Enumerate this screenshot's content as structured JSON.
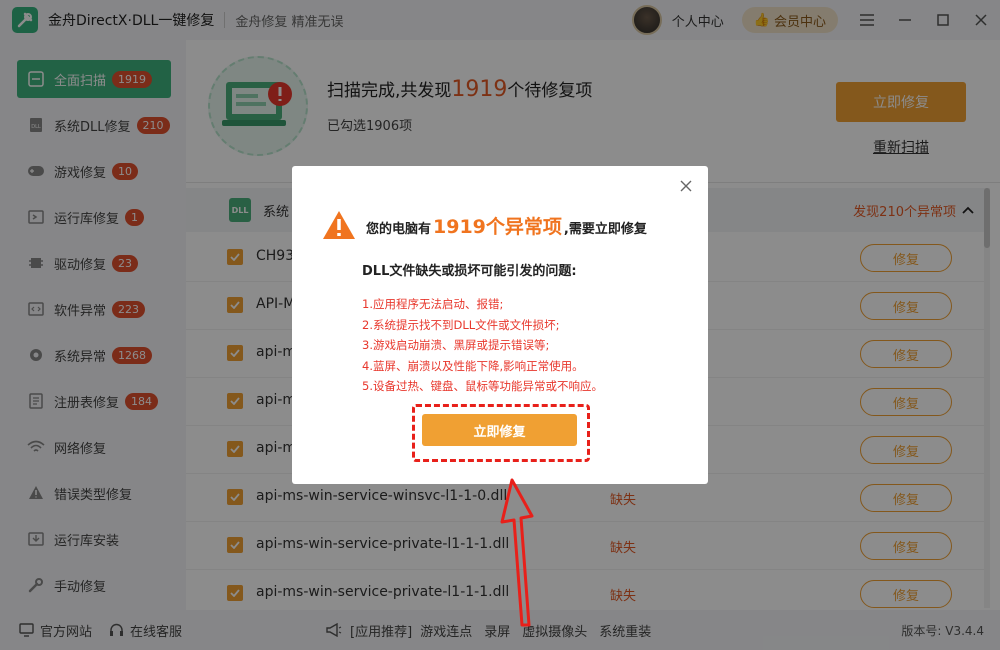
{
  "app": {
    "title": "金舟DirectX·DLL一键修复",
    "slogan": "金舟修复 精准无误",
    "personal_center": "个人中心",
    "vip_center": "会员中心"
  },
  "sidebar": {
    "items": [
      {
        "label": "全面扫描",
        "badge": "1919"
      },
      {
        "label": "系统DLL修复",
        "badge": "210"
      },
      {
        "label": "游戏修复",
        "badge": "10"
      },
      {
        "label": "运行库修复",
        "badge": "1"
      },
      {
        "label": "驱动修复",
        "badge": "23"
      },
      {
        "label": "软件异常",
        "badge": "223"
      },
      {
        "label": "系统异常",
        "badge": "1268"
      },
      {
        "label": "注册表修复",
        "badge": "184"
      },
      {
        "label": "网络修复",
        "badge": ""
      },
      {
        "label": "错误类型修复",
        "badge": ""
      },
      {
        "label": "运行库安装",
        "badge": ""
      },
      {
        "label": "手动修复",
        "badge": ""
      }
    ]
  },
  "scan": {
    "msg_pre": "扫描完成,共发现",
    "count": "1919",
    "msg_post": "个待修复项",
    "selected": "已勾选1906项",
    "fix_now": "立即修复",
    "rescan": "重新扫描"
  },
  "group": {
    "title": "系统",
    "found": "发现210个异常项",
    "icon_text": "DLL"
  },
  "rows": [
    {
      "name": "CH93",
      "status": "",
      "action": "修复"
    },
    {
      "name": "API-M",
      "status": "",
      "action": "修复"
    },
    {
      "name": "api-m",
      "status": "",
      "action": "修复"
    },
    {
      "name": "api-m",
      "status": "",
      "action": "修复"
    },
    {
      "name": "api-m",
      "status": "",
      "action": "修复"
    },
    {
      "name": "api-ms-win-service-winsvc-l1-1-0.dll",
      "status": "缺失",
      "action": "修复"
    },
    {
      "name": "api-ms-win-service-private-l1-1-1.dll",
      "status": "缺失",
      "action": "修复"
    },
    {
      "name": "api-ms-win-service-private-l1-1-1.dll",
      "status": "缺失",
      "action": "修复"
    }
  ],
  "footer": {
    "website": "官方网站",
    "service": "在线客服",
    "recommend": "[应用推荐]",
    "links": [
      "游戏连点",
      "录屏",
      "虚拟摄像头",
      "系统重装"
    ],
    "version": "版本号: V3.4.4"
  },
  "dialog": {
    "warn_pre": "您的电脑有",
    "warn_num": "1919个异常项",
    "warn_post": ",需要立即修复",
    "cause_title": "DLL文件缺失或损坏可能引发的问题:",
    "causes": [
      "1.应用程序无法启动、报错;",
      "2.系统提示找不到DLL文件或文件损坏;",
      "3.游戏启动崩溃、黑屏或提示错误等;",
      "4.蓝屏、崩溃以及性能下降,影响正常使用。",
      "5.设备过热、键盘、鼠标等功能异常或不响应。"
    ],
    "fix_now": "立即修复"
  },
  "colors": {
    "accent_green": "#3fb27f",
    "accent_orange": "#f0a033",
    "alert_red": "#e8372c"
  }
}
